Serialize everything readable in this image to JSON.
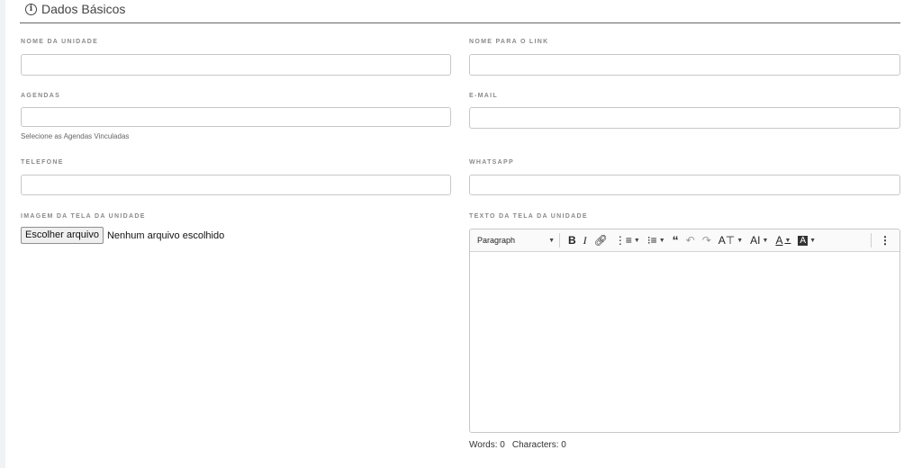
{
  "section": {
    "icon": "info-circle-icon",
    "title": "Dados Básicos"
  },
  "fields": {
    "nome_unidade": {
      "label": "NOME DA UNIDADE",
      "value": ""
    },
    "nome_link": {
      "label": "NOME PARA O LINK",
      "value": ""
    },
    "agendas": {
      "label": "AGENDAS",
      "value": "",
      "hint": "Selecione as Agendas Vinculadas"
    },
    "email": {
      "label": "E-MAIL",
      "value": ""
    },
    "telefone": {
      "label": "TELEFONE",
      "value": ""
    },
    "whatsapp": {
      "label": "WHATSAPP",
      "value": ""
    },
    "imagem": {
      "label": "IMAGEM DA TELA DA UNIDADE",
      "button": "Escolher arquivo",
      "status": "Nenhum arquivo escolhido"
    },
    "texto": {
      "label": "TEXTO DA TELA DA UNIDADE"
    }
  },
  "editor": {
    "paragraph_select": "Paragraph",
    "toolbar": [
      "bold-icon",
      "italic-icon",
      "link-icon",
      "bulleted-list-icon",
      "numbered-list-icon",
      "block-quote-icon",
      "undo-icon",
      "redo-icon",
      "font-size-icon",
      "font-family-icon",
      "font-color-icon",
      "font-background-color-icon",
      "more-options-icon"
    ],
    "words": "Words: 0",
    "characters": "Characters: 0"
  }
}
